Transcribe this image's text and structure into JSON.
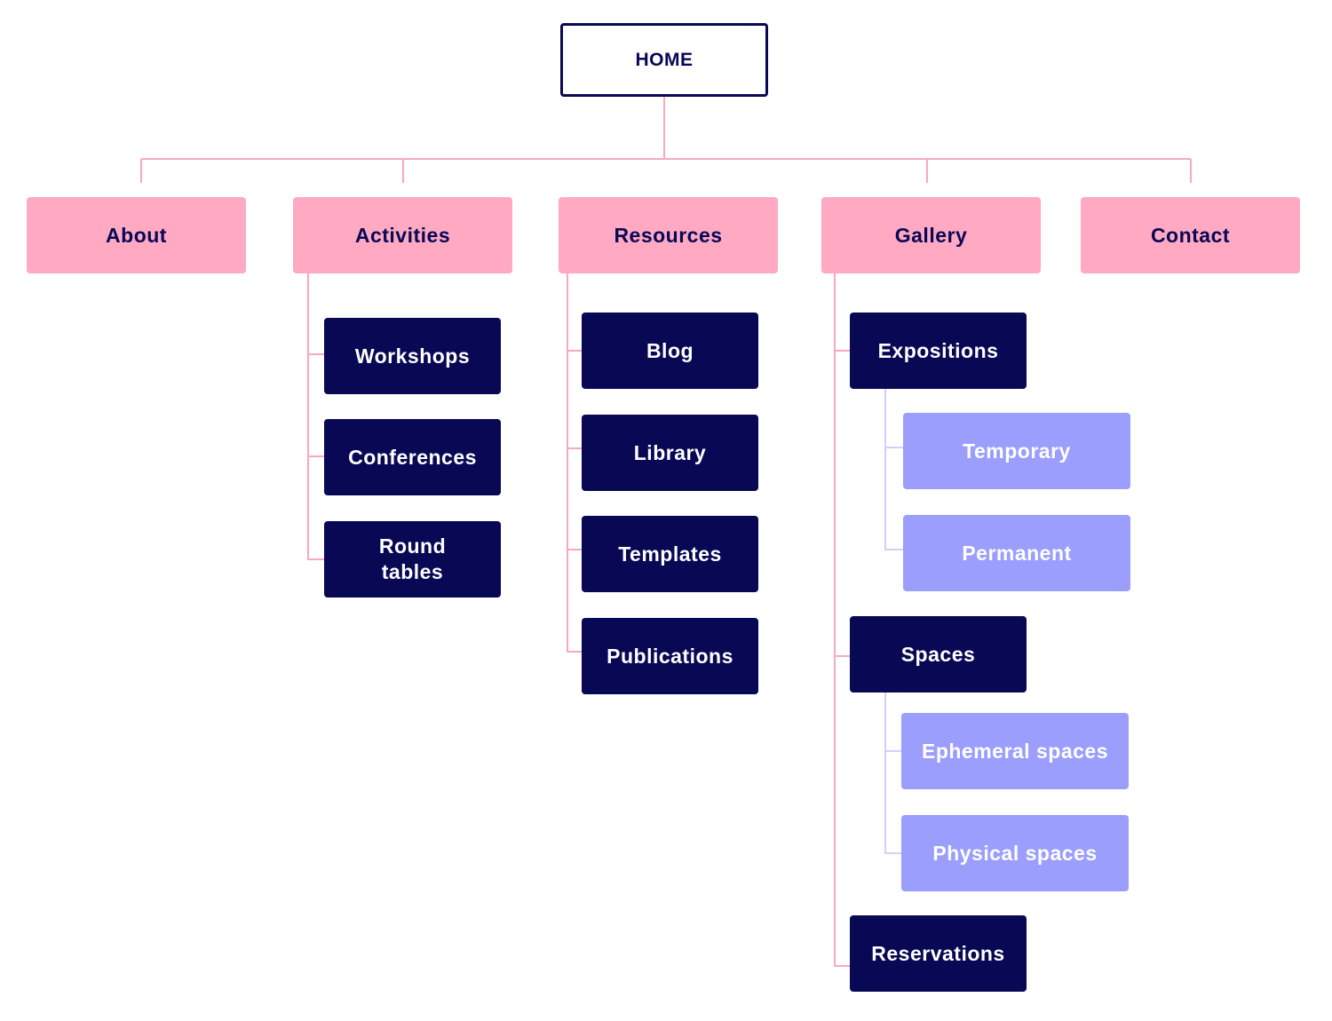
{
  "colors": {
    "navy": "#080855",
    "pink": "#ffa9c2",
    "lavender": "#9b9efd",
    "pink_line": "#f7a8c4",
    "lavender_line": "#d0d0ff"
  },
  "home": "HOME",
  "sections": {
    "about": "About",
    "activities": {
      "label": "Activities",
      "children": [
        "Workshops",
        "Conferences",
        "Round tables"
      ]
    },
    "resources": {
      "label": "Resources",
      "children": [
        "Blog",
        "Library",
        "Templates",
        "Publications"
      ]
    },
    "gallery": {
      "label": "Gallery",
      "expositions": {
        "label": "Expositions",
        "children": [
          "Temporary",
          "Permanent"
        ]
      },
      "spaces": {
        "label": "Spaces",
        "children": [
          "Ephemeral spaces",
          "Physical spaces"
        ]
      },
      "reservations": "Reservations"
    },
    "contact": "Contact"
  }
}
